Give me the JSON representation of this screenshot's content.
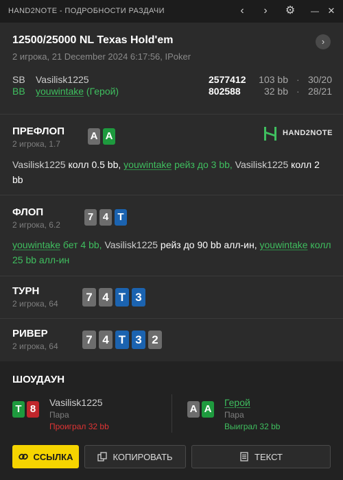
{
  "window": {
    "title": "HAND2NOTE - ПОДРОБНОСТИ РАЗДАЧИ",
    "controls": {
      "back": "‹",
      "forward": "›",
      "settings": "⚙",
      "minimize": "—",
      "close": "✕"
    }
  },
  "game": {
    "title": "12500/25000 NL Texas Hold'em",
    "subtitle": "2 игрока, 21 December 2024 6:17:56, IPoker",
    "next_icon": "›"
  },
  "players": [
    {
      "position": "SB",
      "name": "Vasilisk1225",
      "suffix": "",
      "stack": "2577412",
      "bb": "103 bb",
      "stat": "30/20",
      "hero": false
    },
    {
      "position": "BB",
      "name": "youwintake",
      "suffix": " (Герой)",
      "stack": "802588",
      "bb": "32 bb",
      "stat": "28/21",
      "hero": true
    }
  ],
  "separator": "·",
  "logo": {
    "text": "HAND2NOTE"
  },
  "streets": {
    "preflop": {
      "name": "ПРЕФЛОП",
      "sub": "2 игрока, 1.7",
      "cards": [
        "A",
        "A"
      ],
      "a1_name": "Vasilisk1225",
      "a1_text": " колл 0.5 bb, ",
      "a2_name": "youwintake",
      "a2_text": " рейз до 3 bb, ",
      "a3_name": "Vasilisk1225",
      "a3_text": " колл 2 bb"
    },
    "flop": {
      "name": "ФЛОП",
      "sub": "2 игрока, 6.2",
      "cards": [
        "7",
        "4",
        "T"
      ],
      "a1_name": "youwintake",
      "a1_text": " бет 4 bb, ",
      "a2_name": "Vasilisk1225",
      "a2_text": " рейз до 90 bb алл-ин, ",
      "a3_name": "youwintake",
      "a3_text": " колл 25 bb алл-ин"
    },
    "turn": {
      "name": "ТУРН",
      "sub": "2 игрока, 64",
      "cards": [
        "7",
        "4",
        "T",
        "3"
      ]
    },
    "river": {
      "name": "РИВЕР",
      "sub": "2 игрока, 64",
      "cards": [
        "7",
        "4",
        "T",
        "3",
        "2"
      ]
    }
  },
  "showdown": {
    "title": "ШОУДАУН",
    "villain": {
      "cards": [
        "T",
        "8"
      ],
      "name": "Vasilisk1225",
      "hand": "Пара",
      "result": "Проиграл 32 bb"
    },
    "hero": {
      "cards": [
        "A",
        "A"
      ],
      "name": "Герой",
      "hand": "Пара",
      "result": "Выиграл 32 bb"
    }
  },
  "buttons": {
    "link": "ССЫЛКА",
    "copy": "КОПИРОВАТЬ",
    "text": "ТЕКСТ"
  },
  "colors": {
    "accent_green": "#3fbf5f",
    "loss_red": "#e03434",
    "button_yellow": "#f5d400",
    "card_spade": "#6d6d6d",
    "card_diamond": "#1b63b0",
    "card_club": "#1e9a3e",
    "card_heart": "#c0262c"
  },
  "icons": [
    "chevron-left-icon",
    "chevron-right-icon",
    "gear-icon",
    "minimize-icon",
    "close-icon",
    "link-icon",
    "copy-icon",
    "document-icon"
  ]
}
